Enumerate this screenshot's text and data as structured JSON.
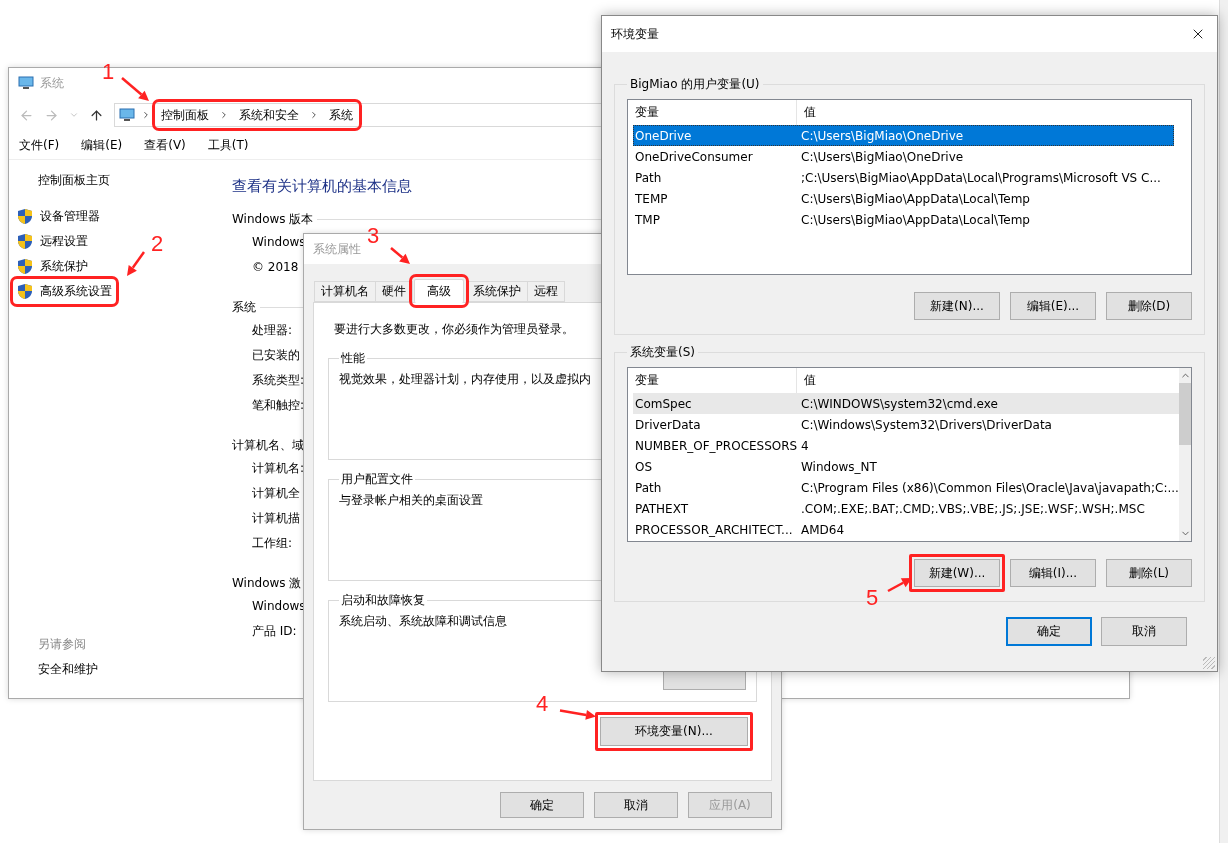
{
  "explorer": {
    "title": "系统",
    "breadcrumb": [
      "控制面板",
      "系统和安全",
      "系统"
    ],
    "breadcrumb_highlighted": true,
    "menu": [
      "文件(F)",
      "编辑(E)",
      "查看(V)",
      "工具(T)"
    ],
    "sidebar": {
      "home": "控制面板主页",
      "items": [
        {
          "label": "设备管理器",
          "highlighted": false
        },
        {
          "label": "远程设置",
          "highlighted": false
        },
        {
          "label": "系统保护",
          "highlighted": false
        },
        {
          "label": "高级系统设置",
          "highlighted": true
        }
      ],
      "see_also_title": "另请参阅",
      "see_also": [
        "安全和维护"
      ]
    },
    "heading": "查看有关计算机的基本信息",
    "sections": [
      {
        "title": "Windows 版本",
        "rows": [
          "Windows",
          "© 2018"
        ]
      },
      {
        "title": "系统",
        "rows": [
          "处理器:",
          "已安装的",
          "系统类型:",
          "笔和触控:"
        ]
      },
      {
        "title": "计算机名、域",
        "rows": [
          "计算机名:",
          "计算机全",
          "计算机描",
          "工作组:"
        ]
      },
      {
        "title": "Windows 激",
        "rows": [
          "Windows",
          "产品 ID:"
        ]
      }
    ]
  },
  "sysprops": {
    "title": "系统属性",
    "tabs": [
      {
        "label": "计算机名",
        "selected": false,
        "highlighted": false
      },
      {
        "label": "硬件",
        "selected": false,
        "highlighted": false
      },
      {
        "label": "高级",
        "selected": true,
        "highlighted": true
      },
      {
        "label": "系统保护",
        "selected": false,
        "highlighted": false
      },
      {
        "label": "远程",
        "selected": false,
        "highlighted": false
      }
    ],
    "notice": "要进行大多数更改，你必须作为管理员登录。",
    "groups": [
      {
        "title": "性能",
        "text": "视觉效果，处理器计划，内存使用，以及虚拟内"
      },
      {
        "title": "用户配置文件",
        "text": "与登录帐户相关的桌面设置"
      },
      {
        "title": "启动和故障恢复",
        "text": "系统启动、系统故障和调试信息",
        "settings_button": true
      }
    ],
    "env_button": {
      "label": "环境变量(N)...",
      "highlighted": true
    },
    "buttons": [
      {
        "label": "确定",
        "disabled": false
      },
      {
        "label": "取消",
        "disabled": false
      },
      {
        "label": "应用(A)",
        "disabled": true
      }
    ]
  },
  "envvars": {
    "title": "环境变量",
    "groups": [
      {
        "title": "BigMiao 的用户变量(U)",
        "focused": true,
        "scrollable": false,
        "columns": [
          "变量",
          "值"
        ],
        "rows": [
          {
            "name": "OneDrive",
            "value": "C:\\Users\\BigMiao\\OneDrive",
            "selected": true
          },
          {
            "name": "OneDriveConsumer",
            "value": "C:\\Users\\BigMiao\\OneDrive",
            "selected": false
          },
          {
            "name": "Path",
            "value": ";C:\\Users\\BigMiao\\AppData\\Local\\Programs\\Microsoft VS C...",
            "selected": false
          },
          {
            "name": "TEMP",
            "value": "C:\\Users\\BigMiao\\AppData\\Local\\Temp",
            "selected": false
          },
          {
            "name": "TMP",
            "value": "C:\\Users\\BigMiao\\AppData\\Local\\Temp",
            "selected": false
          }
        ],
        "buttons": [
          {
            "label": "新建(N)...",
            "highlighted": false
          },
          {
            "label": "编辑(E)...",
            "highlighted": false
          },
          {
            "label": "删除(D)",
            "highlighted": false
          }
        ]
      },
      {
        "title": "系统变量(S)",
        "focused": false,
        "scrollable": true,
        "columns": [
          "变量",
          "值"
        ],
        "rows": [
          {
            "name": "ComSpec",
            "value": "C:\\WINDOWS\\system32\\cmd.exe",
            "selected": true
          },
          {
            "name": "DriverData",
            "value": "C:\\Windows\\System32\\Drivers\\DriverData",
            "selected": false
          },
          {
            "name": "NUMBER_OF_PROCESSORS",
            "value": "4",
            "selected": false
          },
          {
            "name": "OS",
            "value": "Windows_NT",
            "selected": false
          },
          {
            "name": "Path",
            "value": "C:\\Program Files (x86)\\Common Files\\Oracle\\Java\\javapath;C:...",
            "selected": false
          },
          {
            "name": "PATHEXT",
            "value": ".COM;.EXE;.BAT;.CMD;.VBS;.VBE;.JS;.JSE;.WSF;.WSH;.MSC",
            "selected": false
          },
          {
            "name": "PROCESSOR_ARCHITECT...",
            "value": "AMD64",
            "selected": false
          }
        ],
        "buttons": [
          {
            "label": "新建(W)...",
            "highlighted": true
          },
          {
            "label": "编辑(I)...",
            "highlighted": false
          },
          {
            "label": "删除(L)",
            "highlighted": false
          }
        ]
      }
    ],
    "buttons": [
      {
        "label": "确定",
        "default": true
      },
      {
        "label": "取消",
        "default": false
      }
    ]
  },
  "annotations": [
    {
      "label": "1"
    },
    {
      "label": "2"
    },
    {
      "label": "3"
    },
    {
      "label": "4"
    },
    {
      "label": "5"
    }
  ]
}
